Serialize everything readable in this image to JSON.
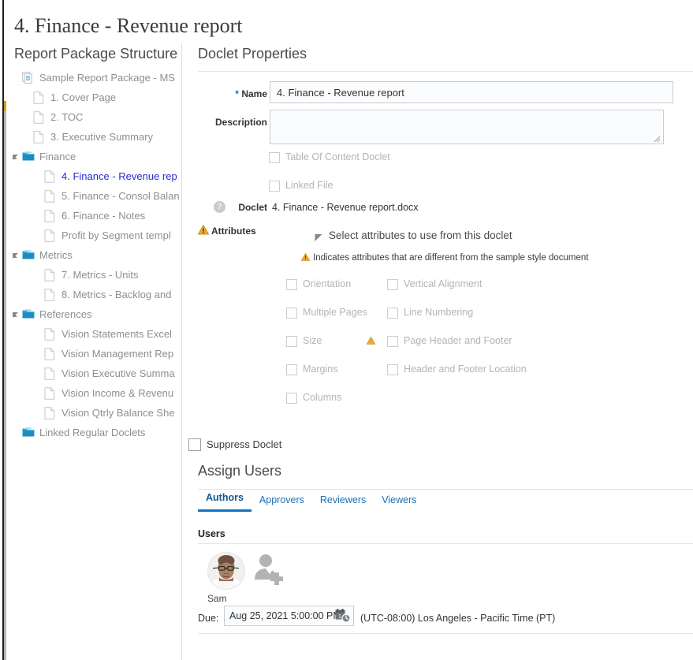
{
  "page": {
    "title": "4. Finance - Revenue report"
  },
  "left_panel": {
    "heading": "Report Package Structure",
    "tree": [
      {
        "label": "Sample Report Package - MS",
        "icon": "report-package-icon",
        "indent": 30,
        "twisty": false,
        "selected": false
      },
      {
        "label": "1. Cover Page",
        "icon": "document-icon",
        "indent": 44,
        "twisty": false,
        "selected": false
      },
      {
        "label": "2. TOC",
        "icon": "document-icon",
        "indent": 44,
        "twisty": false,
        "selected": false
      },
      {
        "label": "3. Executive Summary",
        "icon": "document-icon",
        "indent": 44,
        "twisty": false,
        "selected": false
      },
      {
        "label": "Finance",
        "icon": "folder-icon",
        "indent": 30,
        "twisty": true,
        "selected": false
      },
      {
        "label": "4. Finance - Revenue rep",
        "icon": "document-icon",
        "indent": 58,
        "twisty": false,
        "selected": true
      },
      {
        "label": "5. Finance - Consol Balan",
        "icon": "document-icon",
        "indent": 58,
        "twisty": false,
        "selected": false
      },
      {
        "label": "6. Finance - Notes",
        "icon": "document-icon",
        "indent": 58,
        "twisty": false,
        "selected": false
      },
      {
        "label": "Profit by Segment templ",
        "icon": "document-icon",
        "indent": 58,
        "twisty": false,
        "selected": false
      },
      {
        "label": "Metrics",
        "icon": "folder-icon",
        "indent": 30,
        "twisty": true,
        "selected": false
      },
      {
        "label": "7. Metrics - Units",
        "icon": "document-icon",
        "indent": 58,
        "twisty": false,
        "selected": false
      },
      {
        "label": "8. Metrics - Backlog and",
        "icon": "document-icon",
        "indent": 58,
        "twisty": false,
        "selected": false
      },
      {
        "label": "References",
        "icon": "folder-icon",
        "indent": 30,
        "twisty": true,
        "selected": false
      },
      {
        "label": "Vision Statements Excel",
        "icon": "document-icon",
        "indent": 58,
        "twisty": false,
        "selected": false
      },
      {
        "label": "Vision Management Rep",
        "icon": "document-icon",
        "indent": 58,
        "twisty": false,
        "selected": false
      },
      {
        "label": "Vision Executive Summa",
        "icon": "document-icon",
        "indent": 58,
        "twisty": false,
        "selected": false
      },
      {
        "label": "Vision Income & Revenu",
        "icon": "document-icon",
        "indent": 58,
        "twisty": false,
        "selected": false
      },
      {
        "label": "Vision Qtrly Balance She",
        "icon": "document-icon",
        "indent": 58,
        "twisty": false,
        "selected": false
      },
      {
        "label": "Linked Regular Doclets",
        "icon": "folder-icon",
        "indent": 30,
        "twisty": false,
        "selected": false
      }
    ]
  },
  "right_panel": {
    "heading": "Doclet Properties",
    "name_label": "Name",
    "name_required_marker": "*",
    "name_value": "4. Finance - Revenue report",
    "description_label": "Description",
    "description_value": "",
    "toc_doclet_label": "Table Of Content Doclet",
    "linked_file_label": "Linked File",
    "doclet_label": "Doclet",
    "doclet_help_icon": "help-icon",
    "doclet_value": "4. Finance - Revenue report.docx",
    "attributes_label": "Attributes",
    "attributes_warning_icon": "warning-triangle-icon",
    "attributes_section_title": "Select attributes to use from this doclet",
    "attributes_note": "Indicates attributes that are different from the sample style document",
    "attributes_note_icon": "warning-triangle-icon",
    "attributes": [
      {
        "label": "Orientation",
        "checked": false,
        "warn": false
      },
      {
        "label": "Vertical Alignment",
        "checked": false,
        "warn": false
      },
      {
        "label": "Multiple Pages",
        "checked": false,
        "warn": false
      },
      {
        "label": "Line Numbering",
        "checked": false,
        "warn": false
      },
      {
        "label": "Size",
        "checked": false,
        "warn": false
      },
      {
        "label": "Page Header and Footer",
        "checked": false,
        "warn": true
      },
      {
        "label": "Margins",
        "checked": false,
        "warn": false
      },
      {
        "label": "Header and Footer Location",
        "checked": false,
        "warn": false
      },
      {
        "label": "Columns",
        "checked": false,
        "warn": false
      }
    ],
    "suppress_doclet_label": "Suppress Doclet",
    "assign_users_heading": "Assign Users",
    "tabs": [
      {
        "label": "Authors",
        "active": true
      },
      {
        "label": "Approvers",
        "active": false
      },
      {
        "label": "Reviewers",
        "active": false
      },
      {
        "label": "Viewers",
        "active": false
      }
    ],
    "users_label": "Users",
    "user": {
      "name": "Sam",
      "avatar_icon": "user-photo-avatar",
      "add_user_icon": "add-user-icon"
    },
    "due_label": "Due:",
    "due_value": "Aug 25, 2021 5:00:00 PM",
    "due_picker_icon": "calendar-clock-icon",
    "timezone": "(UTC-08:00) Los Angeles - Pacific Time (PT)"
  },
  "colors": {
    "accent": "#1273c4",
    "link": "#1f6fb5",
    "selected_tree": "#2a2ad0",
    "warning": "#e8a33d",
    "muted": "#b0b5ba"
  }
}
